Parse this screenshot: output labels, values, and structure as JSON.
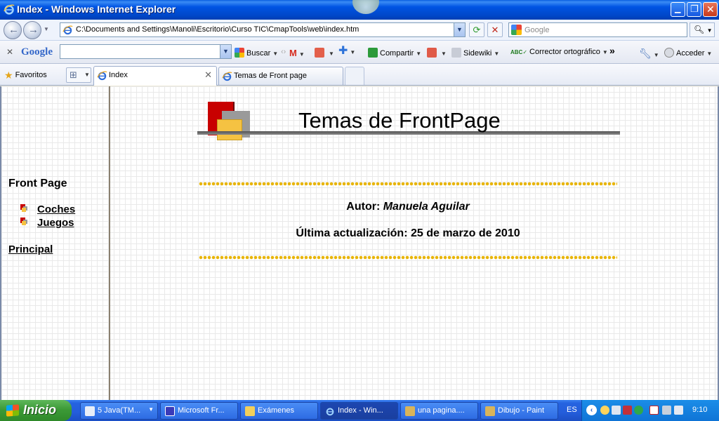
{
  "window": {
    "title": "Index - Windows Internet Explorer",
    "minimize_glyph": "▁",
    "maximize_glyph": "❐",
    "close_glyph": "✕"
  },
  "address_bar": {
    "url": "C:\\Documents and Settings\\Manoli\\Escritorio\\Curso TIC\\CmapTools\\web\\index.htm",
    "search_placeholder": "Google"
  },
  "google_toolbar": {
    "logo": "Google",
    "buscar": "Buscar",
    "compartir": "Compartir",
    "sidewiki": "Sidewiki",
    "corrector": "Corrector ortográfico",
    "more": "»",
    "acceder": "Acceder"
  },
  "tabs_row": {
    "favorites": "Favoritos",
    "tabs": [
      {
        "label": "Index"
      },
      {
        "label": "Temas de Front page"
      }
    ]
  },
  "page": {
    "banner_title": "Temas de FrontPage",
    "nav_heading": "Front Page",
    "nav_links": [
      "Coches",
      "Juegos"
    ],
    "principal_link": "Principal",
    "author_label": "Autor:",
    "author_name": "Manuela Aguilar",
    "updated": "Última actualización: 25 de marzo de 2010"
  },
  "taskbar": {
    "start": "Inicio",
    "tasks": [
      {
        "label": "5 Java(TM..."
      },
      {
        "label": "Microsoft Fr..."
      },
      {
        "label": "Exámenes"
      },
      {
        "label": "Index - Win..."
      },
      {
        "label": "una pagina...."
      },
      {
        "label": "Dibujo - Paint"
      }
    ],
    "language": "ES",
    "clock": "9:10"
  }
}
